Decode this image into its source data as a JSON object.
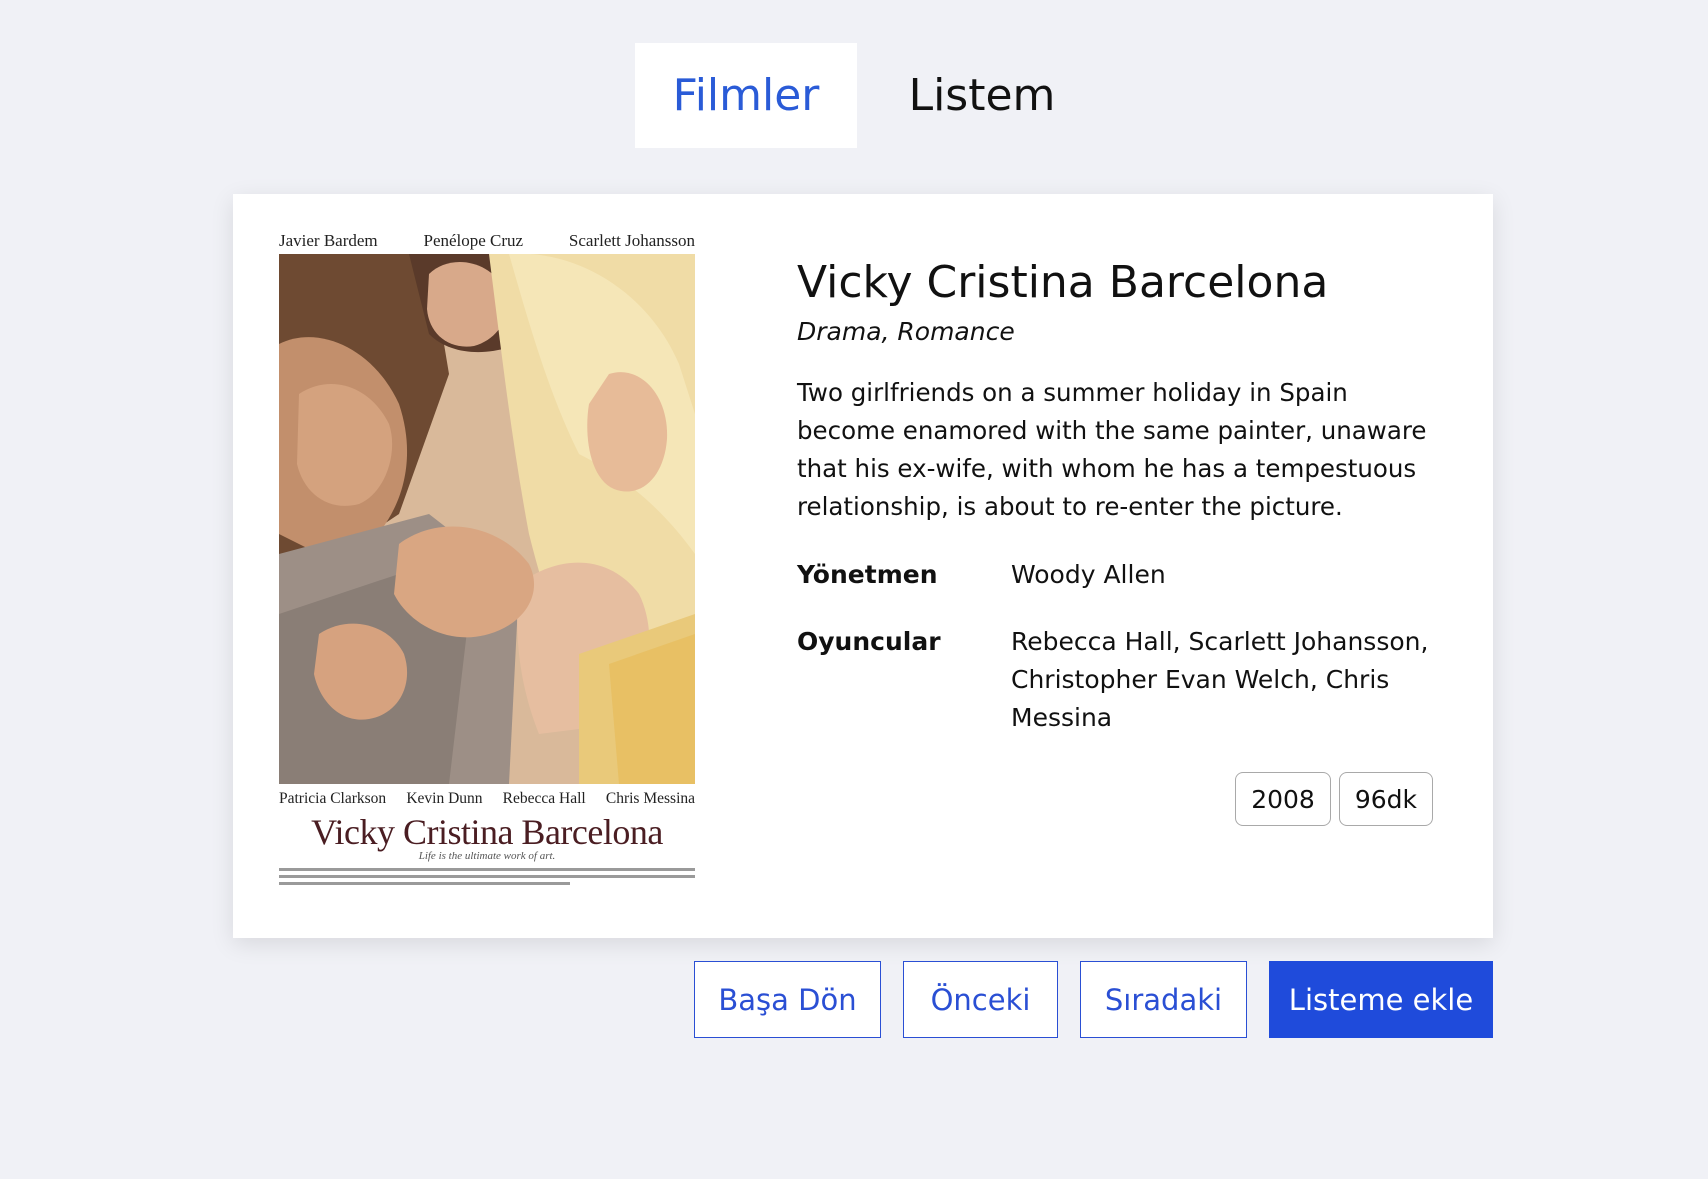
{
  "nav": {
    "tabs": [
      {
        "label": "Filmler",
        "active": true
      },
      {
        "label": "Listem",
        "active": false
      }
    ]
  },
  "poster": {
    "top_cast": [
      "Javier Bardem",
      "Penélope Cruz",
      "Scarlett Johansson"
    ],
    "bottom_cast": [
      "Patricia Clarkson",
      "Kevin Dunn",
      "Rebecca Hall",
      "Chris Messina"
    ],
    "title": "Vicky Cristina Barcelona",
    "tagline": "Life is the ultimate work of art."
  },
  "movie": {
    "title": "Vicky Cristina Barcelona",
    "genres": "Drama, Romance",
    "plot": "Two girlfriends on a summer holiday in Spain become enamored with the same painter, unaware that his ex-wife, with whom he has a tempestuous relationship, is about to re-enter the picture.",
    "director_label": "Yönetmen",
    "director": "Woody Allen",
    "cast_label": "Oyuncular",
    "cast": "Rebecca Hall, Scarlett Johansson, Christopher Evan Welch, Chris Messina",
    "year": "2008",
    "runtime": "96dk"
  },
  "actions": {
    "first": "Başa Dön",
    "prev": "Önceki",
    "next": "Sıradaki",
    "add": "Listeme ekle"
  },
  "colors": {
    "accent": "#1f4bdb",
    "tab_active_text": "#2a5bd7",
    "background": "#f0f1f6"
  }
}
